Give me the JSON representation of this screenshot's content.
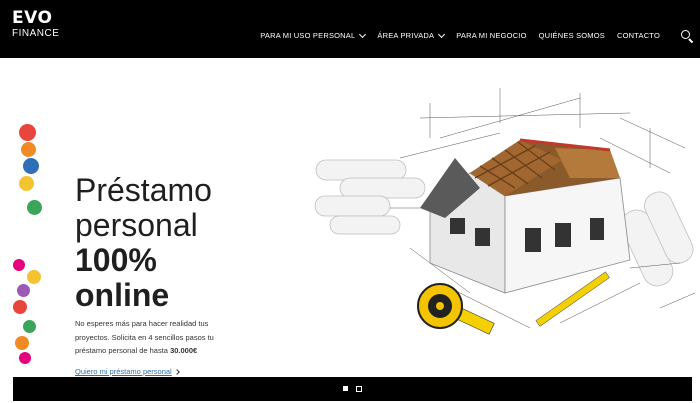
{
  "logo": {
    "line1": "EVO",
    "line2": "FINANCE"
  },
  "nav": {
    "items": [
      {
        "label": "PARA MI USO PERSONAL",
        "dropdown": true
      },
      {
        "label": "ÁREA PRIVADA",
        "dropdown": true
      },
      {
        "label": "PARA MI NEGOCIO",
        "dropdown": false
      },
      {
        "label": "QUIÉNES SOMOS",
        "dropdown": false
      },
      {
        "label": "CONTACTO",
        "dropdown": false
      }
    ],
    "search_icon": "search-icon"
  },
  "hero": {
    "headline": {
      "line1": "Préstamo",
      "line2": "personal",
      "line3": "100%",
      "line4": "online"
    },
    "lead": {
      "line1": "No esperes más para hacer realidad tus",
      "line2": "proyectos. Solicita en 4 sencillos pasos tu",
      "line3_text": "préstamo personal de hasta ",
      "line3_bold": "30.000€"
    },
    "cta": "Quiero mi préstamo personal"
  },
  "colors": {
    "topbar": "#000000",
    "accent_link": "#2f6fa8",
    "dots": [
      "#e8453c",
      "#f08a24",
      "#2e6fb7",
      "#f4c430",
      "#3ba55c",
      "#e6007e",
      "#f4c430",
      "#9b59b6",
      "#e8453c",
      "#3ba55c",
      "#f08a24",
      "#e6007e"
    ]
  },
  "slider": {
    "active_index": 0,
    "count": 2
  }
}
